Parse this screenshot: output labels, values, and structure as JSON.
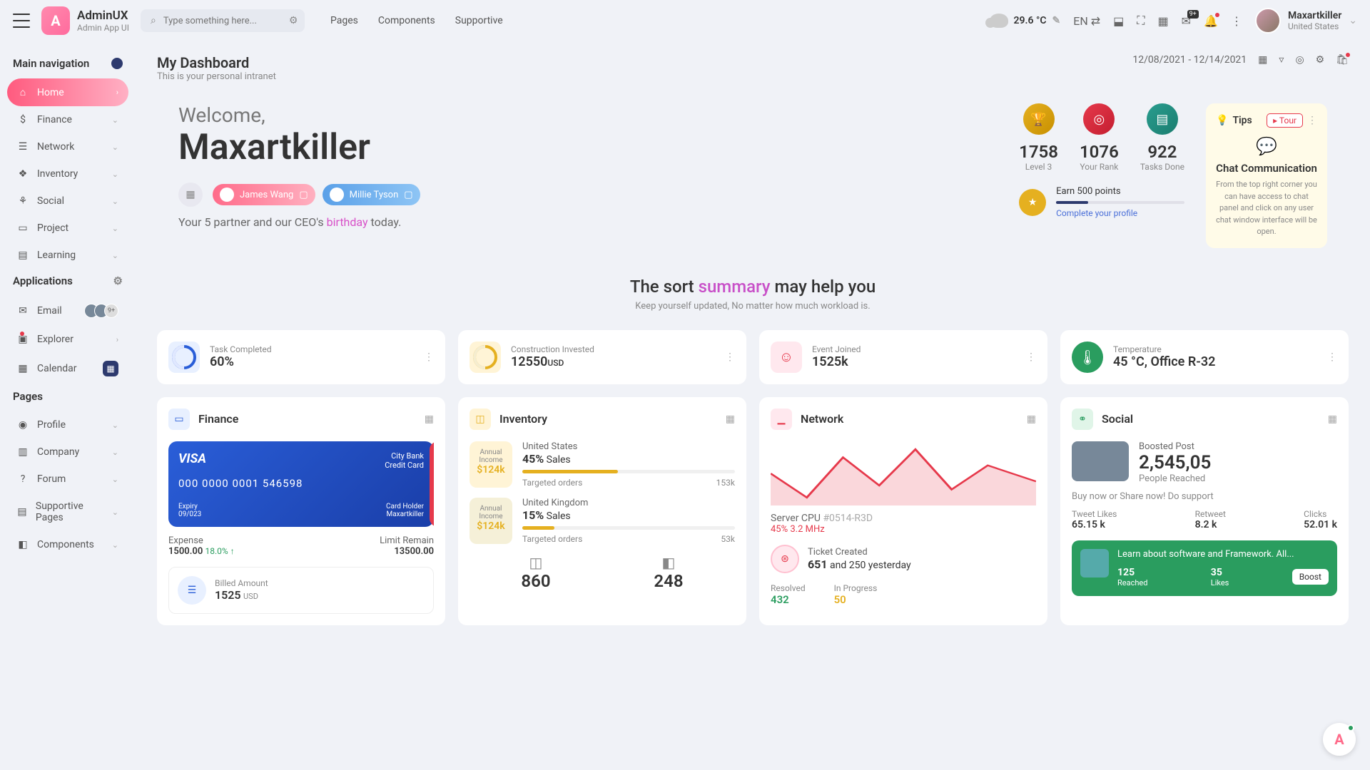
{
  "brand": {
    "name": "AdminUX",
    "sub": "Admin App UI"
  },
  "search": {
    "placeholder": "Type something here..."
  },
  "topnav": {
    "pages": "Pages",
    "components": "Components",
    "supportive": "Supportive"
  },
  "weather": {
    "temp": "29.6 °C"
  },
  "lang": "EN",
  "msgBadge": "9+",
  "user": {
    "name": "Maxartkiller",
    "country": "United States"
  },
  "sidebar": {
    "mainNav": "Main navigation",
    "items": [
      "Home",
      "Finance",
      "Network",
      "Inventory",
      "Social",
      "Project",
      "Learning"
    ],
    "apps": "Applications",
    "appItems": {
      "email": "Email",
      "explorer": "Explorer",
      "calendar": "Calendar",
      "emailCount": "9+"
    },
    "pages": "Pages",
    "pageItems": [
      "Profile",
      "Company",
      "Forum",
      "Supportive Pages",
      "Components"
    ]
  },
  "pageHead": {
    "title": "My Dashboard",
    "sub": "This is your personal intranet",
    "dateRange": "12/08/2021 - 12/14/2021"
  },
  "welcome": {
    "greet": "Welcome,",
    "name": "Maxartkiller",
    "chip1": "James Wang",
    "chip2": "Millie Tyson",
    "partnerPre": "Your 5 partner and our CEO's ",
    "birthday": "birthday",
    "partnerPost": " today."
  },
  "stats": {
    "s1": {
      "n": "1758",
      "l": "Level 3"
    },
    "s2": {
      "n": "1076",
      "l": "Your Rank"
    },
    "s3": {
      "n": "922",
      "l": "Tasks Done"
    }
  },
  "earn": {
    "t1": "Earn 500 points",
    "t2": "Complete your profile"
  },
  "tips": {
    "head": "Tips",
    "tour": "Tour",
    "title": "Chat Communication",
    "desc": "From the top right corner you can have access to chat panel and click on any user chat window interface will be open."
  },
  "summary": {
    "pre": "The sort ",
    "hl": "summary",
    "post": " may help you",
    "sub": "Keep yourself updated, No matter how much workload is."
  },
  "kpi": {
    "task": {
      "l": "Task Completed",
      "v": "60%"
    },
    "constr": {
      "l": "Construction Invested",
      "v": "12550",
      "u": "USD"
    },
    "event": {
      "l": "Event Joined",
      "v": "1525k"
    },
    "temp": {
      "l": "Temperature",
      "v": "45 °C, Office R-32"
    }
  },
  "finance": {
    "title": "Finance",
    "cc": {
      "brand": "VISA",
      "bank": "City Bank",
      "type": "Credit Card",
      "num": "000 0000 0001 546598",
      "expLbl": "Expiry",
      "exp": "09/023",
      "holdLbl": "Card Holder",
      "hold": "Maxartkiller"
    },
    "expLbl": "Expense",
    "expVal": "1500.00",
    "expPct": "18.0%",
    "limLbl": "Limit Remain",
    "limVal": "13500.00",
    "billLbl": "Billed Amount",
    "billVal": "1525",
    "billUnit": "USD"
  },
  "inventory": {
    "title": "Inventory",
    "box": {
      "l1": "Annual",
      "l2": "Income",
      "v": "$124k"
    },
    "r1": {
      "country": "United States",
      "pct": "45%",
      "sales": "Sales",
      "tgt": "Targeted orders",
      "tgtv": "153k"
    },
    "r2": {
      "country": "United Kingdom",
      "pct": "15%",
      "sales": "Sales",
      "tgt": "Targeted orders",
      "tgtv": "53k"
    },
    "f1": "860",
    "f2": "248"
  },
  "network": {
    "title": "Network",
    "cpu": "Server CPU ",
    "cpuId": "#0514-R3D",
    "freq": "45% 3.2 MHz",
    "tkLbl": "Ticket Created",
    "tkN": "651",
    "tkRest": " and 250 yesterday",
    "resLbl": "Resolved",
    "resV": "432",
    "prgLbl": "In Progress",
    "prgV": "50"
  },
  "social": {
    "title": "Social",
    "bp": "Boosted Post",
    "bpN": "2,545,05",
    "bpR": "People Reached",
    "cta": "Buy now or Share now! Do support",
    "s1l": "Tweet Likes",
    "s1v": "65.15 k",
    "s2l": "Retweet",
    "s2v": "8.2 k",
    "s3l": "Clicks",
    "s3v": "52.01 k",
    "gTxt": "Learn about software and Framework. All...",
    "g1n": "125",
    "g1l": "Reached",
    "g2n": "35",
    "g2l": "Likes",
    "boost": "Boost"
  }
}
